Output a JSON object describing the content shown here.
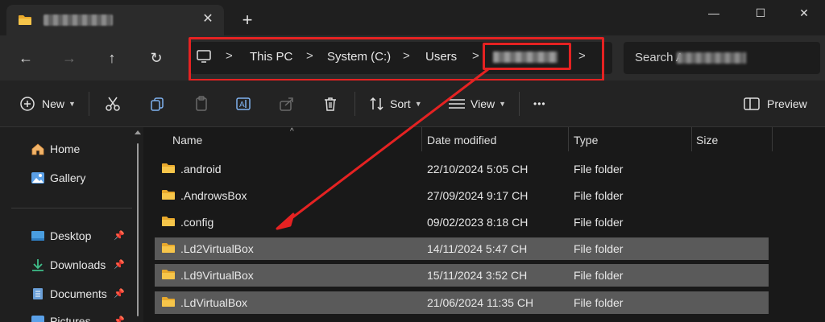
{
  "tab": {
    "close": "✕",
    "new": "+"
  },
  "window": {
    "minimize": "—",
    "maximize": "☐",
    "close": "✕"
  },
  "nav": {
    "back": "←",
    "forward": "→",
    "up": "↑",
    "refresh": "↻"
  },
  "address": {
    "crumbs": [
      "This PC",
      "System (C:)",
      "Users"
    ],
    "separator": ">"
  },
  "search": {
    "placeholder": "Search A"
  },
  "toolbar": {
    "new_label": "New",
    "sort_label": "Sort",
    "view_label": "View",
    "more": "•••",
    "preview_label": "Preview"
  },
  "sidebar": {
    "items": [
      {
        "label": "Home"
      },
      {
        "label": "Gallery"
      },
      {
        "label": "Desktop"
      },
      {
        "label": "Downloads"
      },
      {
        "label": "Documents"
      },
      {
        "label": "Pictures"
      }
    ],
    "pin": "📌"
  },
  "columns": {
    "name": "Name",
    "date": "Date modified",
    "type": "Type",
    "size": "Size"
  },
  "files": [
    {
      "name": ".android",
      "date": "22/10/2024 5:05 CH",
      "type": "File folder",
      "selected": false
    },
    {
      "name": ".AndrowsBox",
      "date": "27/09/2024 9:17 CH",
      "type": "File folder",
      "selected": false
    },
    {
      "name": ".config",
      "date": "09/02/2023 8:18 CH",
      "type": "File folder",
      "selected": false
    },
    {
      "name": ".Ld2VirtualBox",
      "date": "14/11/2024 5:47 CH",
      "type": "File folder",
      "selected": true
    },
    {
      "name": ".Ld9VirtualBox",
      "date": "15/11/2024 3:52 CH",
      "type": "File folder",
      "selected": true
    },
    {
      "name": ".LdVirtualBox",
      "date": "21/06/2024 11:35 CH",
      "type": "File folder",
      "selected": true
    }
  ],
  "colors": {
    "highlight": "#e52222",
    "folder": "#f4c242",
    "selected_row": "#5a5a5a"
  }
}
